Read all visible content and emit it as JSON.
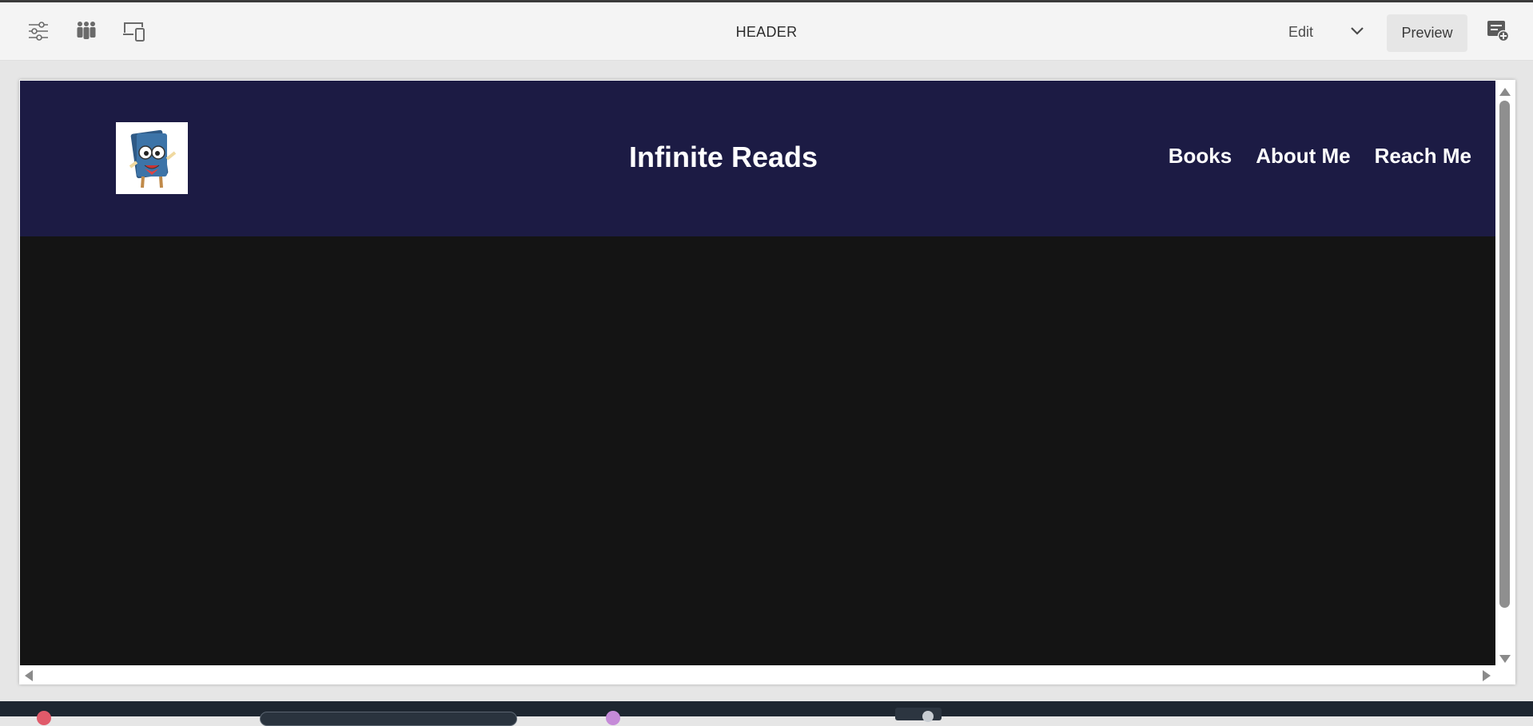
{
  "toolbar": {
    "title": "HEADER",
    "mode_label": "Edit",
    "preview_label": "Preview",
    "icons": [
      "properties-sliders-icon",
      "personas-icon",
      "device-emulator-icon",
      "chevron-down-icon",
      "add-panel-icon"
    ]
  },
  "site": {
    "title": "Infinite Reads",
    "logo": "cartoon-book-mascot-logo",
    "nav": [
      "Books",
      "About Me",
      "Reach Me"
    ],
    "colors": {
      "header_bg": "#1c1b44",
      "body_bg": "#141414",
      "text": "#ffffff"
    }
  }
}
